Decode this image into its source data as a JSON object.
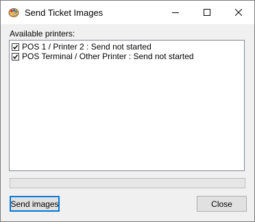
{
  "window": {
    "title": "Send Ticket Images",
    "icon": "palette-icon"
  },
  "caption_buttons": {
    "minimize": "minimize-icon",
    "maximize": "maximize-icon",
    "close": "close-icon"
  },
  "printers_label": "Available printers:",
  "printers": [
    {
      "label": "POS 1 / Printer 2 : Send not started",
      "checked": true
    },
    {
      "label": "POS Terminal / Other Printer : Send not started",
      "checked": true
    }
  ],
  "progress": {
    "value": 0
  },
  "buttons": {
    "send": "Send images",
    "close": "Close"
  },
  "colors": {
    "accent": "#0078d7",
    "button_face": "#e1e1e1",
    "window_bg": "#f0f0f0"
  }
}
